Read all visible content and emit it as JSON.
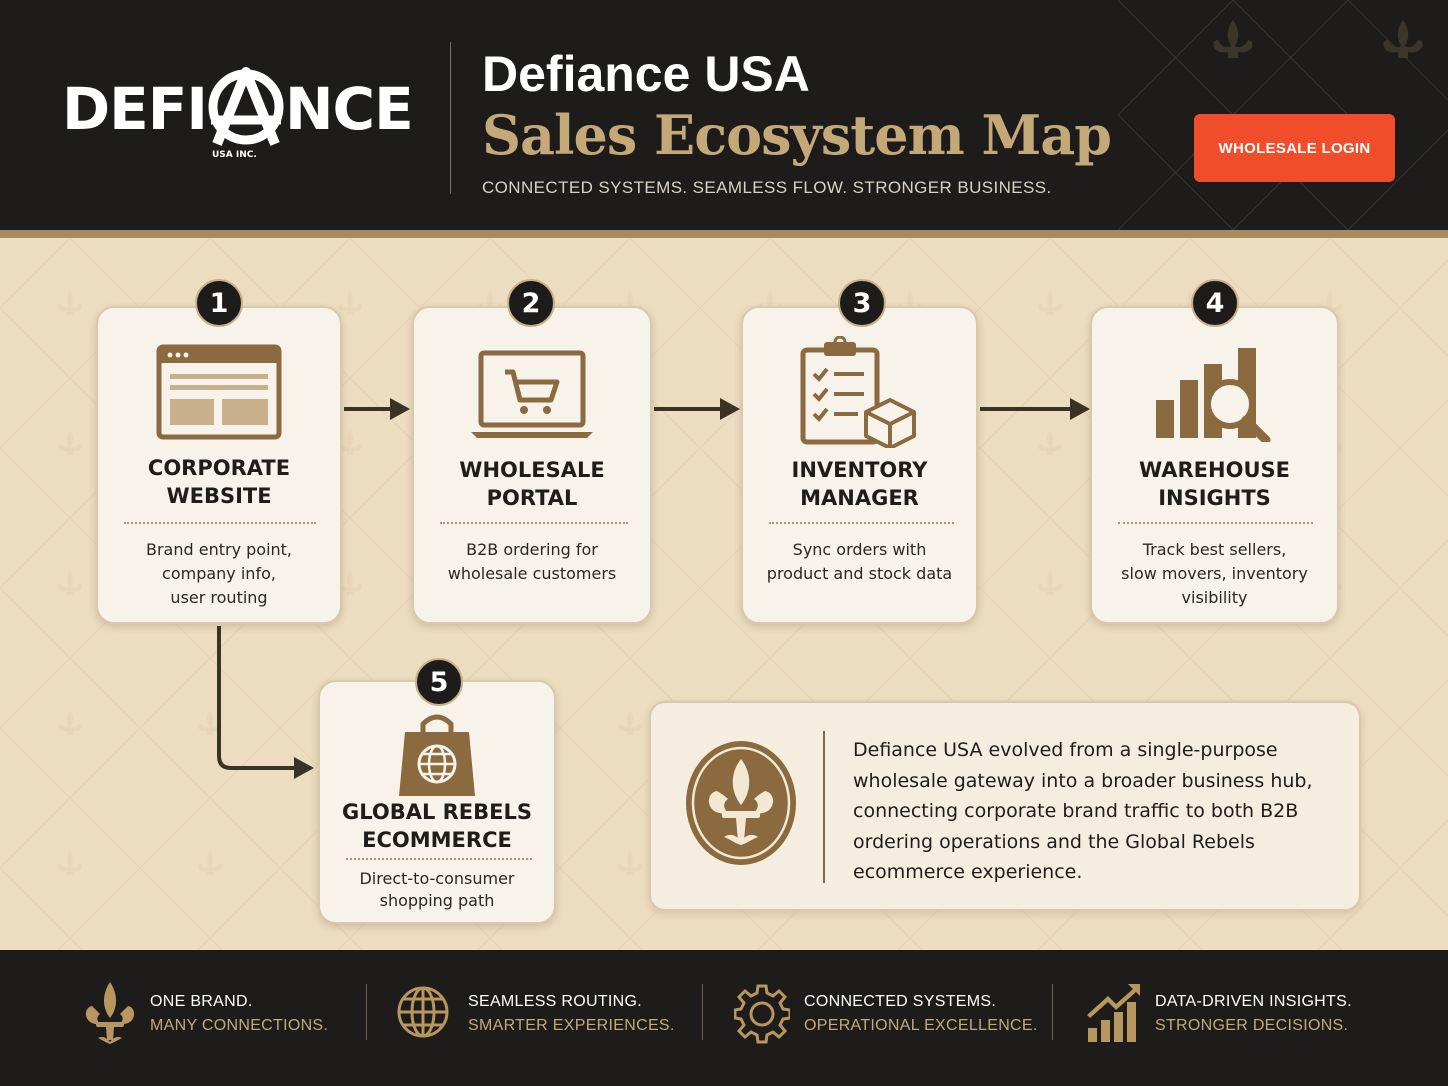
{
  "header": {
    "logo_text_left": "DEFI",
    "logo_text_right": "NCE",
    "logo_sub": "USA INC.",
    "title_line1": "Defiance USA",
    "title_line2": "Sales Ecosystem Map",
    "tagline": "CONNECTED SYSTEMS. SEAMLESS FLOW. STRONGER BUSINESS.",
    "login_label": "WHOLESALE LOGIN"
  },
  "steps": [
    {
      "number": "1",
      "title": [
        "CORPORATE",
        "WEBSITE"
      ],
      "description": [
        "Brand entry point,",
        "company info,",
        "user routing"
      ],
      "icon": "browser-window-icon"
    },
    {
      "number": "2",
      "title": [
        "WHOLESALE",
        "PORTAL"
      ],
      "description": [
        "B2B ordering for",
        "wholesale customers"
      ],
      "icon": "laptop-cart-icon"
    },
    {
      "number": "3",
      "title": [
        "INVENTORY",
        "MANAGER"
      ],
      "description": [
        "Sync orders with",
        "product and stock data"
      ],
      "icon": "clipboard-box-icon"
    },
    {
      "number": "4",
      "title": [
        "WAREHOUSE",
        "INSIGHTS"
      ],
      "description": [
        "Track best sellers,",
        "slow movers, inventory",
        "visibility"
      ],
      "icon": "bar-chart-magnifier-icon"
    },
    {
      "number": "5",
      "title": [
        "GLOBAL REBELS",
        "ECOMMERCE"
      ],
      "description": [
        "Direct-to-consumer",
        "shopping path"
      ],
      "icon": "shopping-bag-globe-icon"
    }
  ],
  "info": {
    "lines": [
      "Defiance USA evolved from a single-purpose",
      "wholesale gateway into a broader business hub,",
      "connecting corporate brand traffic to both B2B",
      "ordering operations and the Global Rebels",
      "ecommerce experience."
    ],
    "icon": "fleur-de-lis-medallion-icon"
  },
  "footer": [
    {
      "line1": "ONE BRAND.",
      "line2": "MANY CONNECTIONS.",
      "icon": "fleur-de-lis-icon"
    },
    {
      "line1": "SEAMLESS ROUTING.",
      "line2": "SMARTER EXPERIENCES.",
      "icon": "globe-icon"
    },
    {
      "line1": "CONNECTED SYSTEMS.",
      "line2": "OPERATIONAL EXCELLENCE.",
      "icon": "gear-icon"
    },
    {
      "line1": "DATA-DRIVEN INSIGHTS.",
      "line2": "STRONGER DECISIONS.",
      "icon": "growth-chart-icon"
    }
  ],
  "colors": {
    "header_bg": "#1d1c1a",
    "gold": "#c4a878",
    "icon_brown": "#8a6a3e",
    "accent_orange": "#f04e2a",
    "main_bg": "#ecdcc0",
    "card_bg": "#f8f3ea"
  }
}
